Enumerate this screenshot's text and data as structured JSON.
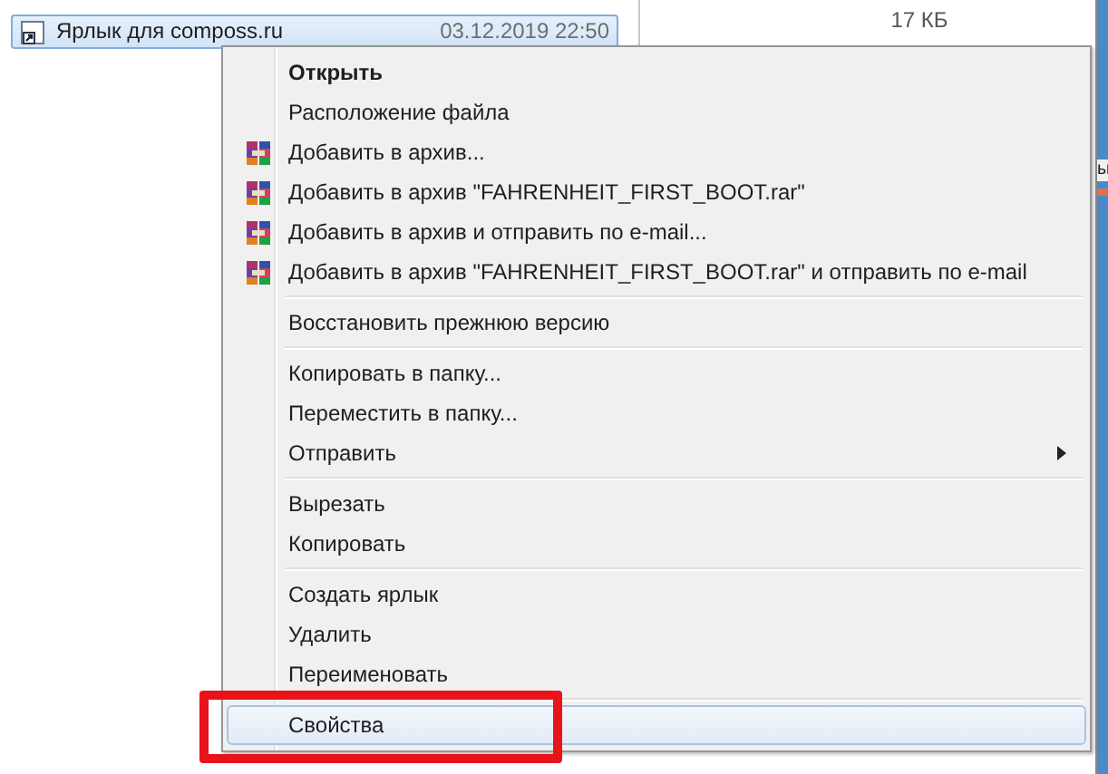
{
  "file_list": {
    "rows": [
      {
        "name": "Ярлык для composs.ru",
        "date": "03.12.2019 22:50",
        "selected": true,
        "kind": "shortcut"
      }
    ]
  },
  "details_pane": {
    "size": "17 КБ"
  },
  "side_strip": {
    "text": "ы"
  },
  "context_menu": {
    "items": [
      {
        "kind": "command",
        "label": "Открыть",
        "default": true,
        "submenu": false,
        "selected": false
      },
      {
        "kind": "command",
        "label": "Расположение файла",
        "default": false,
        "submenu": false,
        "selected": false
      },
      {
        "kind": "archive",
        "label": "Добавить в архив...",
        "default": false,
        "submenu": false,
        "selected": false
      },
      {
        "kind": "archive",
        "label": "Добавить в архив \"FAHRENHEIT_FIRST_BOOT.rar\"",
        "default": false,
        "submenu": false,
        "selected": false
      },
      {
        "kind": "archive",
        "label": "Добавить в архив и отправить по e-mail...",
        "default": false,
        "submenu": false,
        "selected": false
      },
      {
        "kind": "archive",
        "label": "Добавить в архив \"FAHRENHEIT_FIRST_BOOT.rar\" и отправить по e-mail",
        "default": false,
        "submenu": false,
        "selected": false
      },
      {
        "kind": "separator"
      },
      {
        "kind": "command",
        "label": "Восстановить прежнюю версию",
        "default": false,
        "submenu": false,
        "selected": false
      },
      {
        "kind": "separator"
      },
      {
        "kind": "command",
        "label": "Копировать в папку...",
        "default": false,
        "submenu": false,
        "selected": false
      },
      {
        "kind": "command",
        "label": "Переместить в папку...",
        "default": false,
        "submenu": false,
        "selected": false
      },
      {
        "kind": "command",
        "label": "Отправить",
        "default": false,
        "submenu": true,
        "selected": false
      },
      {
        "kind": "separator"
      },
      {
        "kind": "command",
        "label": "Вырезать",
        "default": false,
        "submenu": false,
        "selected": false
      },
      {
        "kind": "command",
        "label": "Копировать",
        "default": false,
        "submenu": false,
        "selected": false
      },
      {
        "kind": "separator"
      },
      {
        "kind": "command",
        "label": "Создать ярлык",
        "default": false,
        "submenu": false,
        "selected": false
      },
      {
        "kind": "command",
        "label": "Удалить",
        "default": false,
        "submenu": false,
        "selected": false
      },
      {
        "kind": "command",
        "label": "Переименовать",
        "default": false,
        "submenu": false,
        "selected": false
      },
      {
        "kind": "separator"
      },
      {
        "kind": "command",
        "label": "Свойства",
        "default": false,
        "submenu": false,
        "selected": true,
        "highlighted": true
      }
    ]
  }
}
